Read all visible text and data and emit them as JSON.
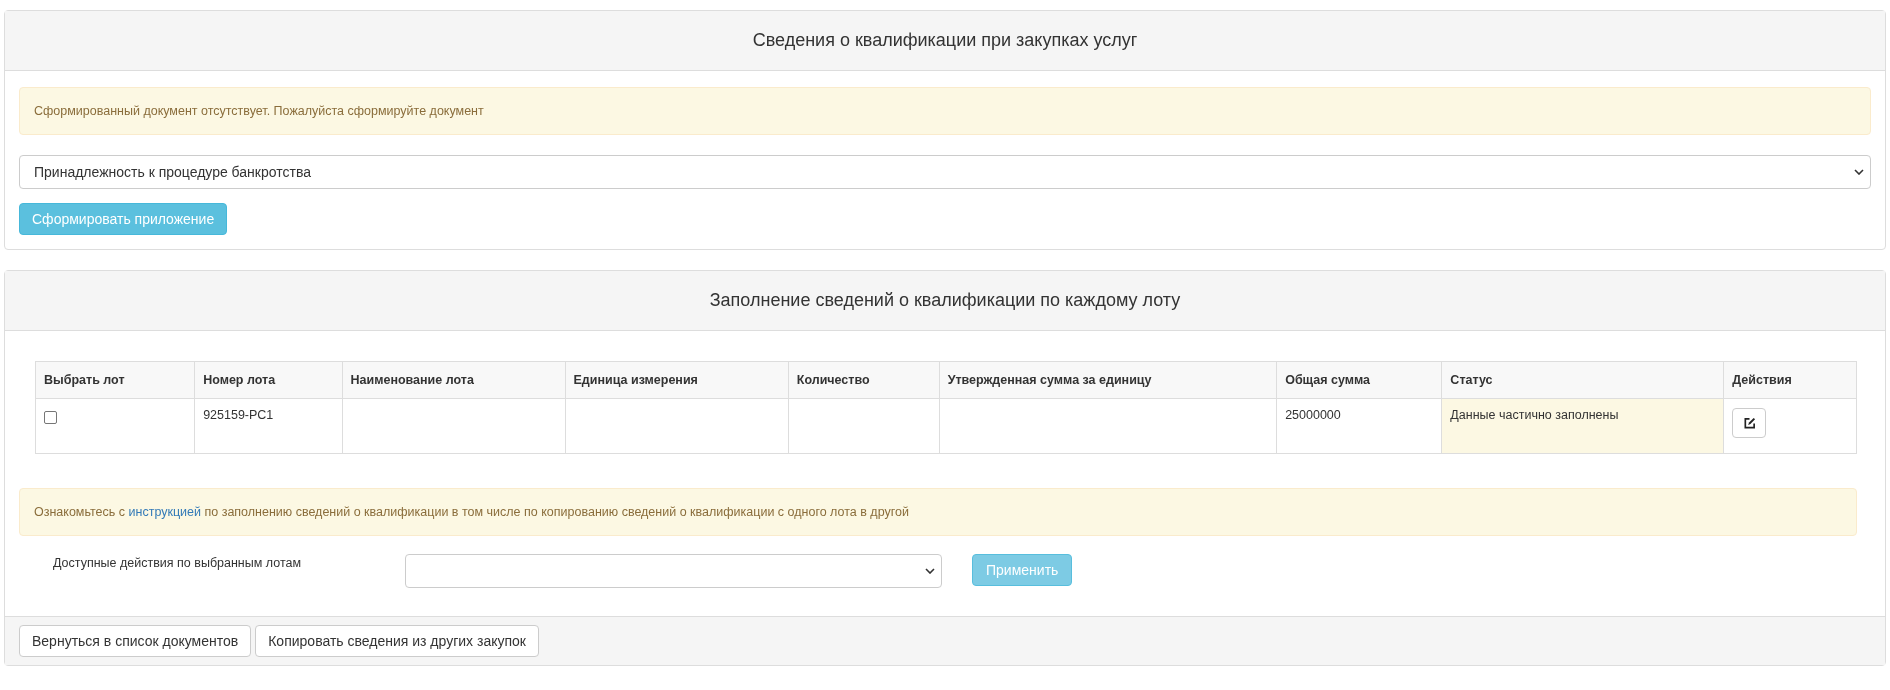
{
  "panels": [
    {
      "title": "Сведения о квалификации при закупках услуг",
      "alert": "Сформированный документ отсутствует. Пожалуйста сформируйте документ",
      "select": {
        "value": "Принадлежность к процедуре банкротства"
      },
      "button": {
        "label": "Сформировать приложение",
        "disabled": false
      }
    },
    {
      "title": "Заполнение сведений о квалификации по каждому лоту",
      "table": {
        "columns": [
          "Выбрать лот",
          "Номер лота",
          "Наименование лота",
          "Единица измерения",
          "Количество",
          "Утвержденная сумма за единицу",
          "Общая сумма",
          "Статус",
          "Действия"
        ],
        "rows": [
          {
            "checked": false,
            "lot_number": "925159-РС1",
            "total": "25000000",
            "status": "Данные частично заполнены",
            "status_highlighted": true
          }
        ]
      },
      "notice": {
        "before": "Ознакомьтесь с",
        "link": "инструкцией",
        "after": "по заполнению сведений о квалификации в том числе по копированию сведений о квалификации с одного лота в другой"
      },
      "bulk": {
        "label": "Доступные действия по выбранным лотам",
        "button": {
          "label": "Применить",
          "disabled": true
        }
      },
      "footer_buttons": [
        "Вернуться в список документов",
        "Копировать сведения из других закупок"
      ]
    }
  ]
}
